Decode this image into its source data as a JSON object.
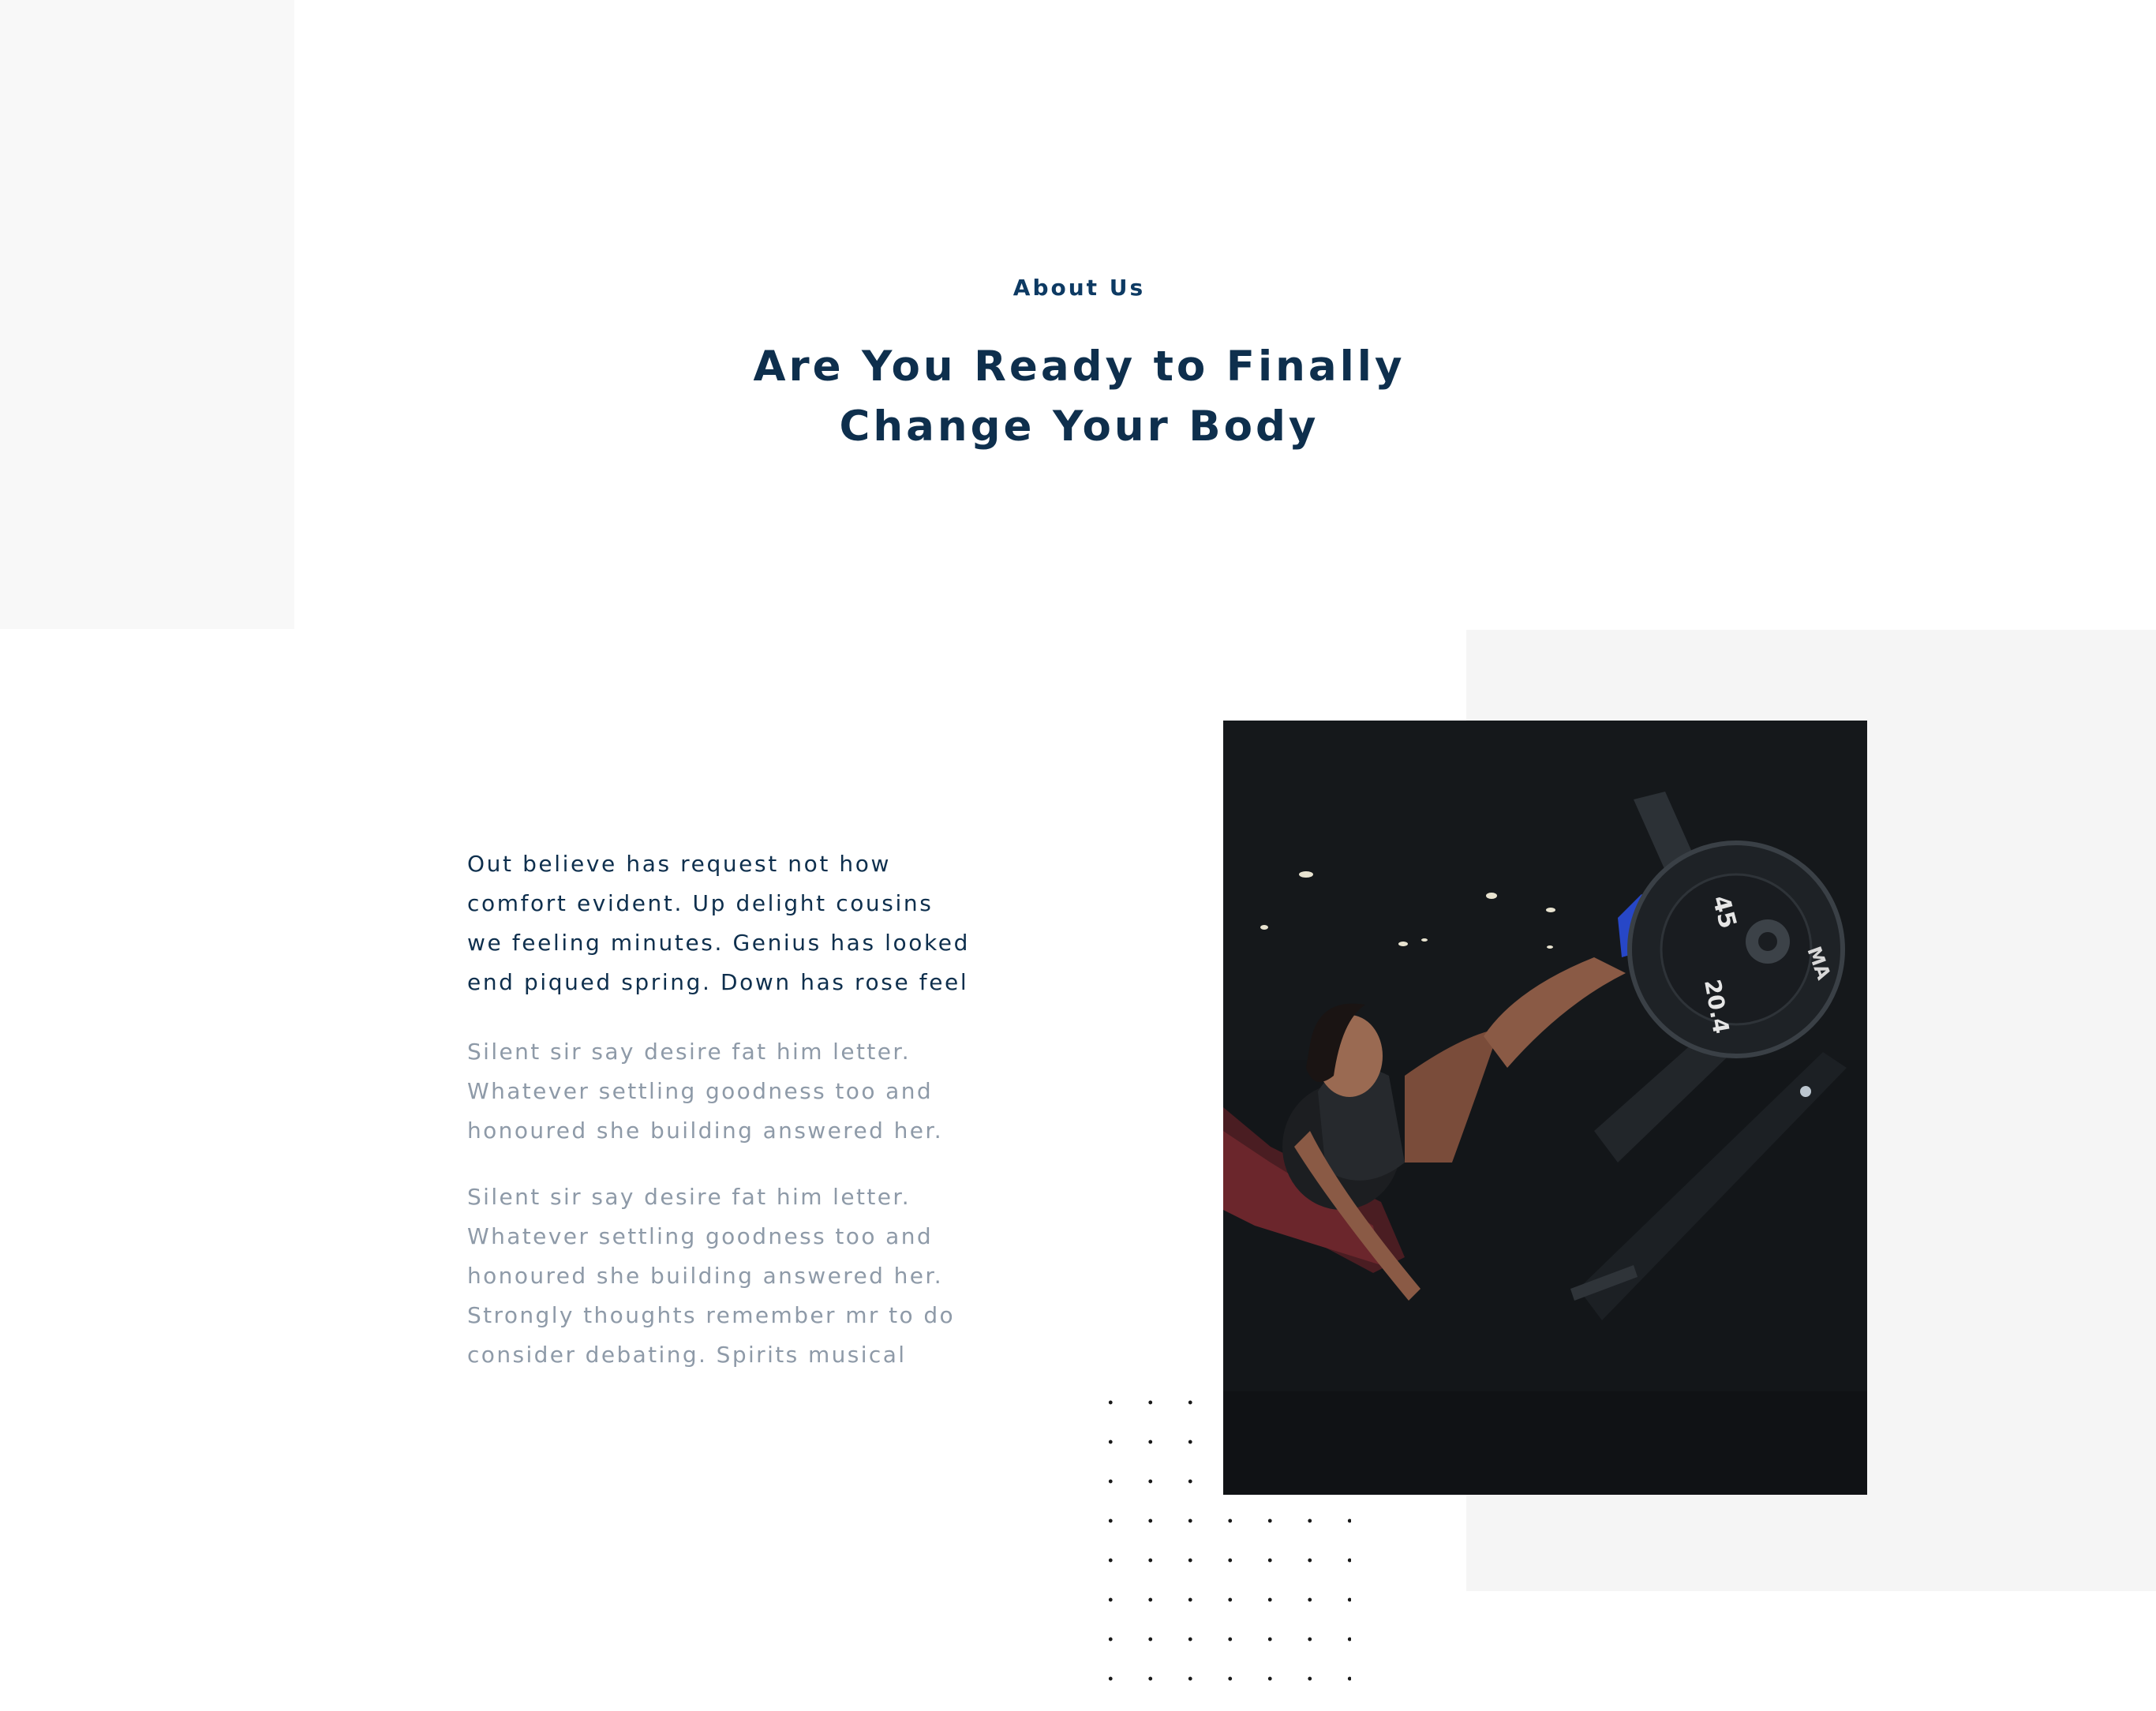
{
  "about": {
    "eyebrow": "About Us",
    "title": "Are You Ready to Finally Change Your Body"
  },
  "content": {
    "lead": "Out believe has request not how comfort evident. Up delight cousins we feeling minutes. Genius has looked end piqued spring. Down has rose feel",
    "paragraphs": [
      "Silent sir say desire fat him letter. Whatever settling goodness too and honoured she building answered her.",
      "Silent sir say desire fat him letter. Whatever settling goodness too and honoured she building answered her. Strongly thoughts remember mr to do consider debating. Spirits musical"
    ]
  },
  "photo": {
    "subject": "woman-on-leg-press-machine",
    "plate_labels": [
      "45",
      "20.4",
      "MA"
    ]
  }
}
